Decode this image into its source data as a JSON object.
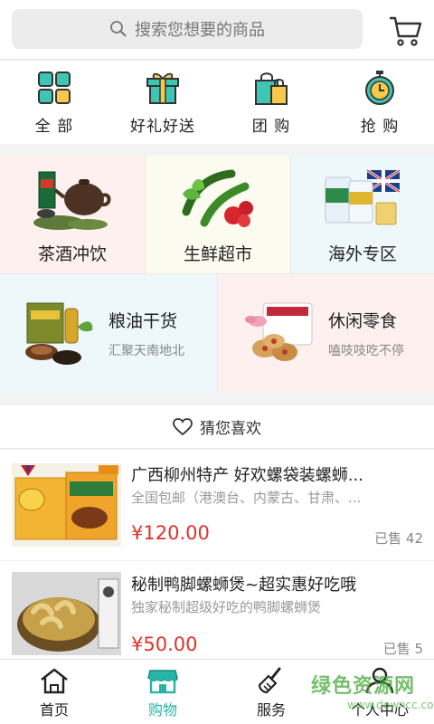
{
  "search": {
    "placeholder": "搜索您想要的商品",
    "icon": "search-icon"
  },
  "cart": {
    "icon": "cart-icon"
  },
  "quick_nav": [
    {
      "label": "全 部",
      "icon": "grid-icon"
    },
    {
      "label": "好礼好送",
      "icon": "gift-icon"
    },
    {
      "label": "团 购",
      "icon": "shopping-bag-icon"
    },
    {
      "label": "抢 购",
      "icon": "alarm-clock-icon"
    }
  ],
  "categories": [
    {
      "name": "茶酒冲饮",
      "image": "tea-set-image",
      "bg": "#fdf0ee"
    },
    {
      "name": "生鲜超市",
      "image": "vegetables-image",
      "bg": "#fbfbef"
    },
    {
      "name": "海外专区",
      "image": "imported-milk-image",
      "bg": "#eef8fb"
    },
    {
      "name": "粮油干货",
      "sub": "汇聚天南地北",
      "image": "oil-mushroom-image",
      "bg": "#eef8fb"
    },
    {
      "name": "休闲零食",
      "sub": "嗑吱吱吃不停",
      "image": "cookies-image",
      "bg": "#fdf0ee"
    }
  ],
  "section": {
    "title": "猜您喜欢",
    "icon": "heart-icon"
  },
  "products": [
    {
      "title": "广西柳州特产 好欢螺袋装螺蛳...",
      "desc": "全国包邮（港澳台、内蒙古、甘肃、...",
      "price": "¥120.00",
      "sold": "已售 42"
    },
    {
      "title": "秘制鸭脚螺蛳煲~超实惠好吃哦",
      "desc": "独家秘制超级好吃的鸭脚螺蛳煲",
      "price": "¥50.00",
      "sold": "已售 5"
    }
  ],
  "tabs": [
    {
      "label": "首页",
      "icon": "home-icon"
    },
    {
      "label": "购物",
      "icon": "shop-icon",
      "active": true
    },
    {
      "label": "服务",
      "icon": "broom-icon"
    },
    {
      "label": "个人中心",
      "icon": "user-icon"
    }
  ],
  "watermark": {
    "text": "绿色资源网",
    "url": "www.downcc.com"
  },
  "colors": {
    "accent": "#27b3a6",
    "price": "#e0322b"
  }
}
